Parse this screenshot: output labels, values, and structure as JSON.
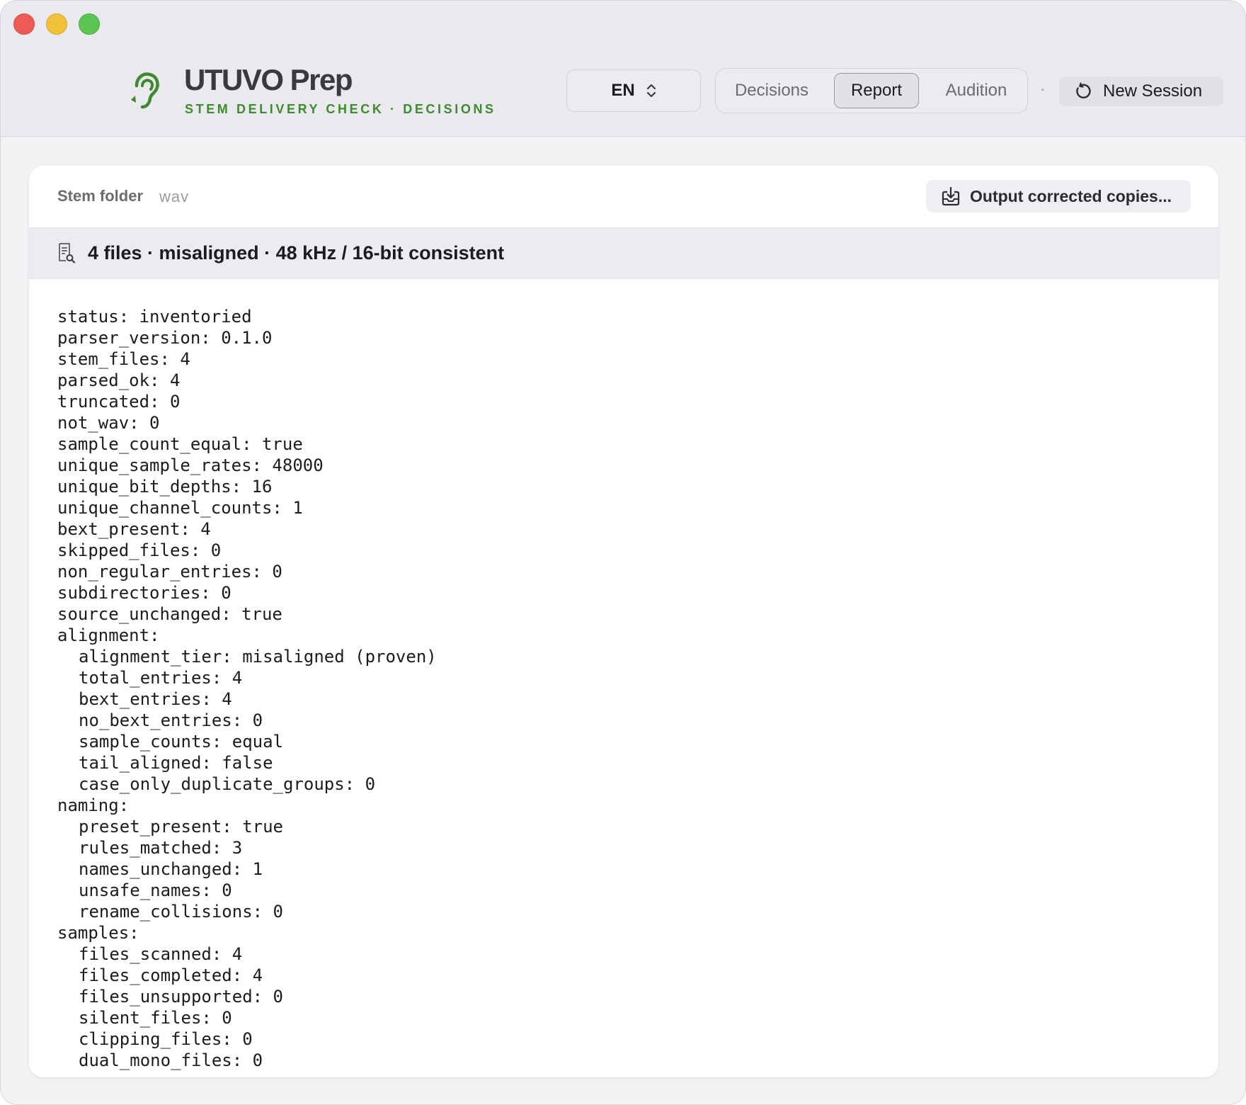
{
  "header": {
    "brand_title": "UTUVO Prep",
    "brand_subtitle": "STEM DELIVERY CHECK · DECISIONS",
    "language": "EN",
    "tabs": [
      {
        "label": "Decisions",
        "selected": false
      },
      {
        "label": "Report",
        "selected": true
      },
      {
        "label": "Audition",
        "selected": false
      }
    ],
    "separator": "·",
    "new_session_label": "New Session"
  },
  "folder": {
    "label": "Stem folder",
    "value": "wav",
    "output_button_label": "Output corrected copies..."
  },
  "summary": {
    "text": "4 files · misaligned · 48 kHz / 16-bit consistent"
  },
  "report_lines": [
    {
      "text": "status: inventoried",
      "indent": 0
    },
    {
      "text": "parser_version: 0.1.0",
      "indent": 0
    },
    {
      "text": "stem_files: 4",
      "indent": 0
    },
    {
      "text": "parsed_ok: 4",
      "indent": 0
    },
    {
      "text": "truncated: 0",
      "indent": 0
    },
    {
      "text": "not_wav: 0",
      "indent": 0
    },
    {
      "text": "sample_count_equal: true",
      "indent": 0
    },
    {
      "text": "unique_sample_rates: 48000",
      "indent": 0
    },
    {
      "text": "unique_bit_depths: 16",
      "indent": 0
    },
    {
      "text": "unique_channel_counts: 1",
      "indent": 0
    },
    {
      "text": "bext_present: 4",
      "indent": 0
    },
    {
      "text": "skipped_files: 0",
      "indent": 0
    },
    {
      "text": "non_regular_entries: 0",
      "indent": 0
    },
    {
      "text": "subdirectories: 0",
      "indent": 0
    },
    {
      "text": "source_unchanged: true",
      "indent": 0
    },
    {
      "text": "alignment:",
      "indent": 0
    },
    {
      "text": "alignment_tier: misaligned (proven)",
      "indent": 1
    },
    {
      "text": "total_entries: 4",
      "indent": 1
    },
    {
      "text": "bext_entries: 4",
      "indent": 1
    },
    {
      "text": "no_bext_entries: 0",
      "indent": 1
    },
    {
      "text": "sample_counts: equal",
      "indent": 1
    },
    {
      "text": "tail_aligned: false",
      "indent": 1
    },
    {
      "text": "case_only_duplicate_groups: 0",
      "indent": 1
    },
    {
      "text": "naming:",
      "indent": 0
    },
    {
      "text": "preset_present: true",
      "indent": 1
    },
    {
      "text": "rules_matched: 3",
      "indent": 1
    },
    {
      "text": "names_unchanged: 1",
      "indent": 1
    },
    {
      "text": "unsafe_names: 0",
      "indent": 1
    },
    {
      "text": "rename_collisions: 0",
      "indent": 1
    },
    {
      "text": "samples:",
      "indent": 0
    },
    {
      "text": "files_scanned: 4",
      "indent": 1
    },
    {
      "text": "files_completed: 4",
      "indent": 1
    },
    {
      "text": "files_unsupported: 0",
      "indent": 1
    },
    {
      "text": "silent_files: 0",
      "indent": 1
    },
    {
      "text": "clipping_files: 0",
      "indent": 1
    },
    {
      "text": "dual_mono_files: 0",
      "indent": 1
    }
  ],
  "colors": {
    "brand_green": "#3f8a2e",
    "header_bg": "#e9e9ee",
    "window_bg": "#f2f2f5"
  },
  "icons": {
    "brand": "ear-icon",
    "language": "chevron-up-down-icon",
    "new_session": "reset-arrow-icon",
    "output": "download-tray-icon",
    "summary": "document-search-icon"
  }
}
